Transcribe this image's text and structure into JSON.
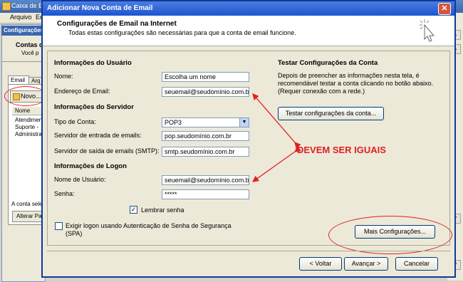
{
  "background_window": {
    "title": "Caixa de En",
    "menu": [
      "Arquivo",
      "Edi"
    ],
    "config_title": "Configurações",
    "contas_title": "Contas d",
    "contas_sub": "Você p",
    "tabs": [
      "Email",
      "Arq"
    ],
    "novo_label": "Novo...",
    "list_header": "Nome",
    "accounts": [
      "Atendimen",
      "Suporte - ",
      "Administra"
    ],
    "account_selected_label": "A conta sele",
    "alterar_label": "Alterar Pas"
  },
  "dialog": {
    "title": "Adicionar Nova Conta de Email",
    "header_title": "Configurações de Email na Internet",
    "header_subtitle": "Todas estas configurações são necessárias para que a conta de email funcione.",
    "user_info": {
      "section": "Informações do Usuário",
      "name_label": "Nome:",
      "name_value": "Escolha um nome",
      "email_label": "Endereço de Email:",
      "email_value": "seuemail@seudomínio.com.br"
    },
    "server_info": {
      "section": "Informações do Servidor",
      "account_type_label": "Tipo de Conta:",
      "account_type_value": "POP3",
      "incoming_label": "Servidor de entrada de emails:",
      "incoming_value": "pop.seudomínio.com.br",
      "outgoing_label": "Servidor de saída de emails (SMTP):",
      "outgoing_value": "smtp.seudomínio.com.br"
    },
    "logon_info": {
      "section": "Informações de Logon",
      "username_label": "Nome de Usuário:",
      "username_value": "seuemail@seudomínio.com.br",
      "password_label": "Senha:",
      "password_value": "*****",
      "remember_label": "Lembrar senha",
      "remember_checked": true,
      "spa_label_line1": "Exigir logon usando Autenticação de Senha de Segurança",
      "spa_label_line2": "(SPA)",
      "spa_checked": false
    },
    "test": {
      "section": "Testar Configurações da Conta",
      "description": [
        "Depois de preencher as informações nesta tela, é",
        "recomendável testar a conta clicando no botão abaixo.",
        "(Requer conexão com a rede.)"
      ],
      "test_button": "Testar configurações da conta..."
    },
    "more_settings_button": "Mais Configurações...",
    "back_button": "< Voltar",
    "next_button": "Avançar >",
    "cancel_button": "Cancelar"
  },
  "annotation": {
    "text": "DEVEM SER IGUAIS",
    "color": "#e02020"
  }
}
